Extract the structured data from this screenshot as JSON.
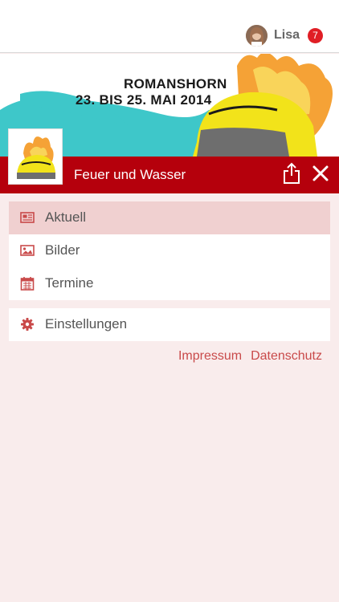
{
  "user": {
    "name": "Lisa",
    "notification_count": "7"
  },
  "banner": {
    "line1": "ROMANSHORN",
    "line2": "23. BIS 25. MAI 2014"
  },
  "header": {
    "title": "Feuer und Wasser",
    "share_icon": "share-icon",
    "close_icon": "close-icon"
  },
  "menu": {
    "main": [
      {
        "label": "Aktuell",
        "icon": "newspaper-icon",
        "active": true
      },
      {
        "label": "Bilder",
        "icon": "image-icon",
        "active": false
      },
      {
        "label": "Termine",
        "icon": "calendar-icon",
        "active": false
      }
    ],
    "secondary": [
      {
        "label": "Einstellungen",
        "icon": "gear-icon",
        "active": false
      }
    ]
  },
  "footer": {
    "impressum": "Impressum",
    "datenschutz": "Datenschutz"
  },
  "colors": {
    "brand": "#b5000c",
    "background": "#f9ecec",
    "active_item": "#f0d0d0",
    "icon": "#c94a4a",
    "badge": "#e01e25"
  }
}
